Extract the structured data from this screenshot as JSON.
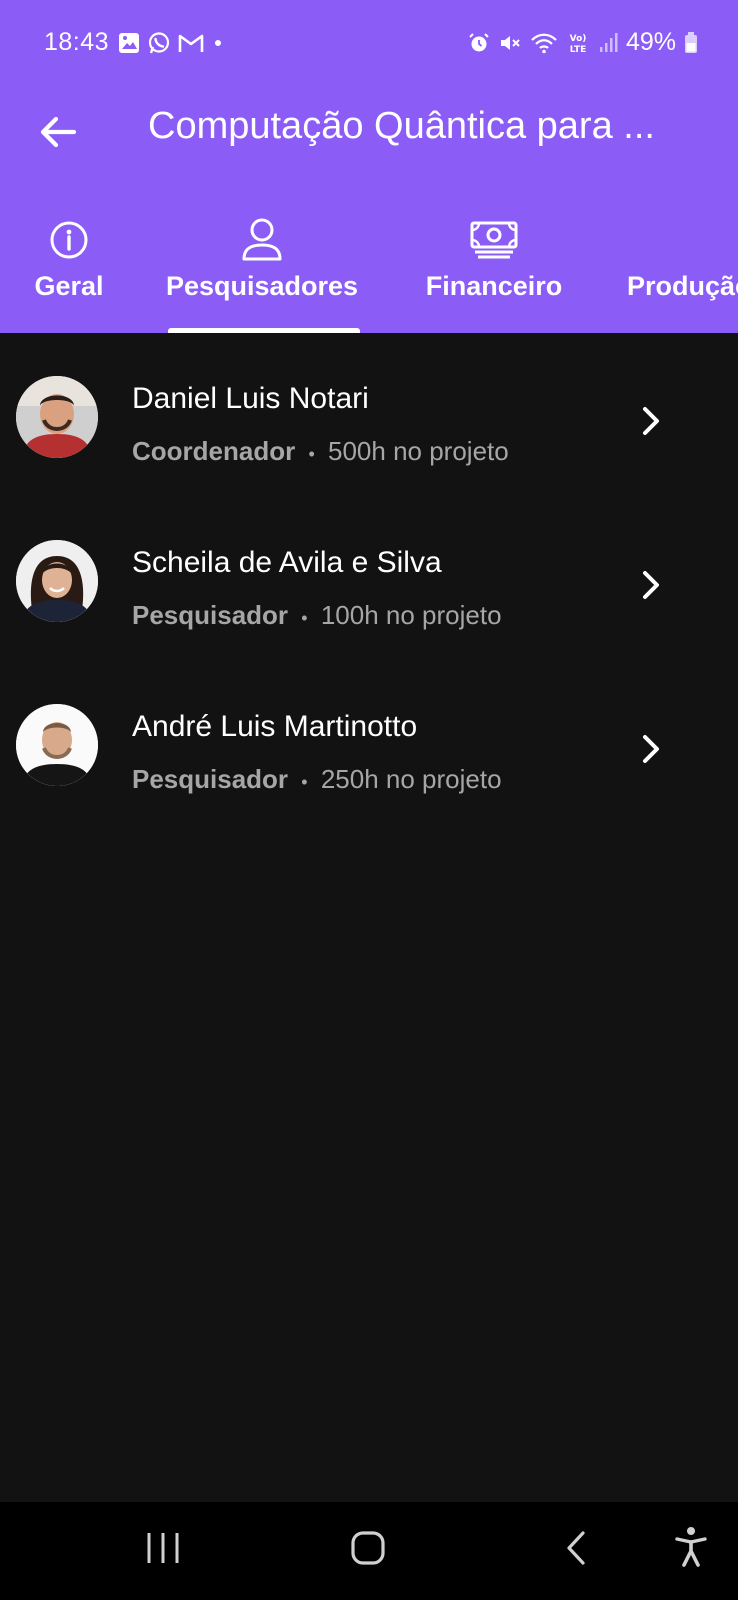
{
  "status": {
    "time": "18:43",
    "battery": "49%"
  },
  "appbar": {
    "title": "Computação Quântica para ..."
  },
  "tabs": [
    {
      "label": "Geral",
      "icon": "info-icon"
    },
    {
      "label": "Pesquisadores",
      "icon": "person-icon",
      "selected": true
    },
    {
      "label": "Financeiro",
      "icon": "money-icon"
    },
    {
      "label": "Produção",
      "icon": ""
    }
  ],
  "researchers": [
    {
      "name": "Daniel Luis Notari",
      "role": "Coordenador",
      "separator": "•",
      "hours": "500h no projeto"
    },
    {
      "name": "Scheila de Avila e Silva",
      "role": "Pesquisador",
      "separator": "•",
      "hours": "100h no projeto"
    },
    {
      "name": "André Luis Martinotto",
      "role": "Pesquisador",
      "separator": "•",
      "hours": "250h no projeto"
    }
  ],
  "colors": {
    "accent": "#8b5cf6",
    "background": "#121212",
    "secondary_text": "#a6a6a6"
  }
}
